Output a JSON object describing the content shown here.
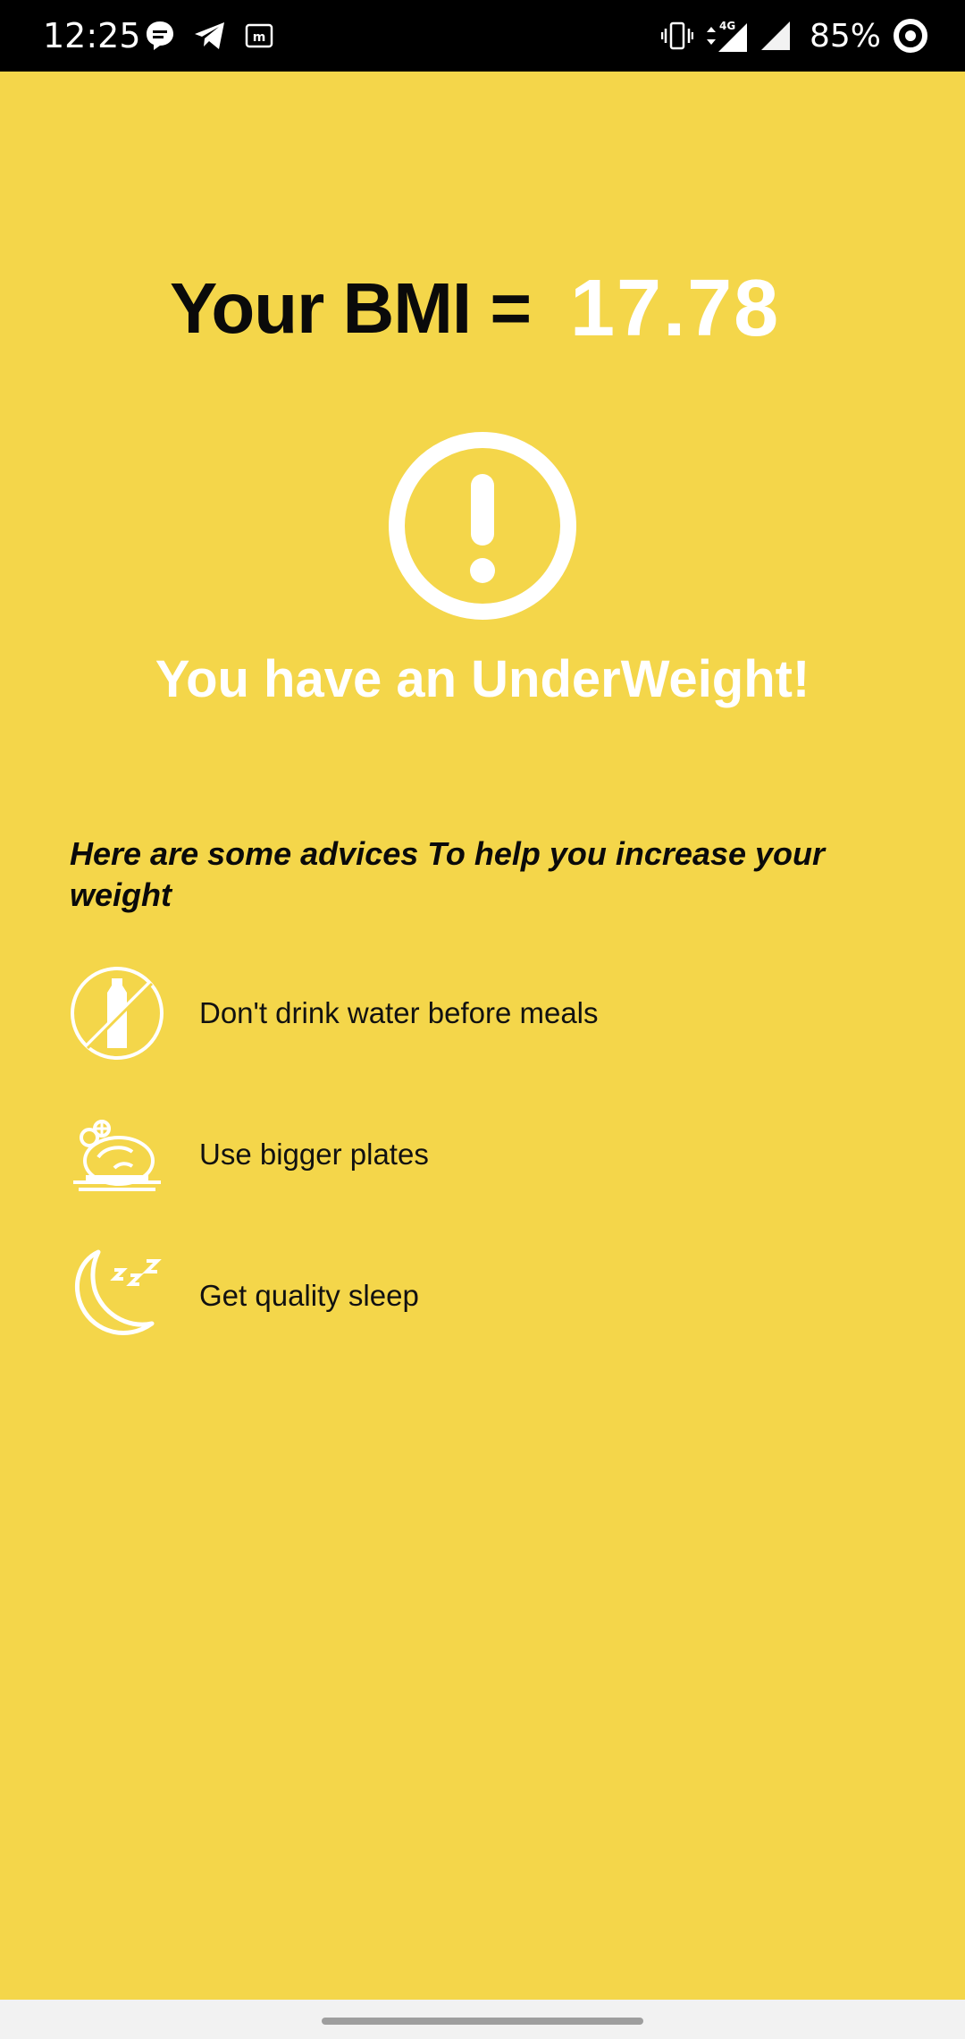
{
  "status_bar": {
    "time": "12:25",
    "battery_percent": "85%",
    "network_label": "4G",
    "left_icons": [
      "chat-bubble-icon",
      "telegram-icon",
      "m-app-icon"
    ],
    "right_icons": [
      "vibrate-icon",
      "data-arrows-icon",
      "signal-icon",
      "signal-icon",
      "battery-ring-icon"
    ]
  },
  "result": {
    "bmi_label": "Your BMI =",
    "bmi_value": "17.78",
    "status_icon": "exclamation-circle-icon",
    "message": "You have an UnderWeight!"
  },
  "advice": {
    "heading": "Here are some advices To help you increase your weight",
    "items": [
      {
        "icon": "no-water-bottle-icon",
        "text": "Don't drink water before meals"
      },
      {
        "icon": "food-plate-icon",
        "text": "Use bigger plates"
      },
      {
        "icon": "moon-sleep-icon",
        "text": "Get quality sleep"
      }
    ]
  },
  "colors": {
    "background": "#F4D64A",
    "accent_text": "#FFFFFF",
    "primary_text": "#0A0A0A",
    "status_bar": "#000000"
  }
}
